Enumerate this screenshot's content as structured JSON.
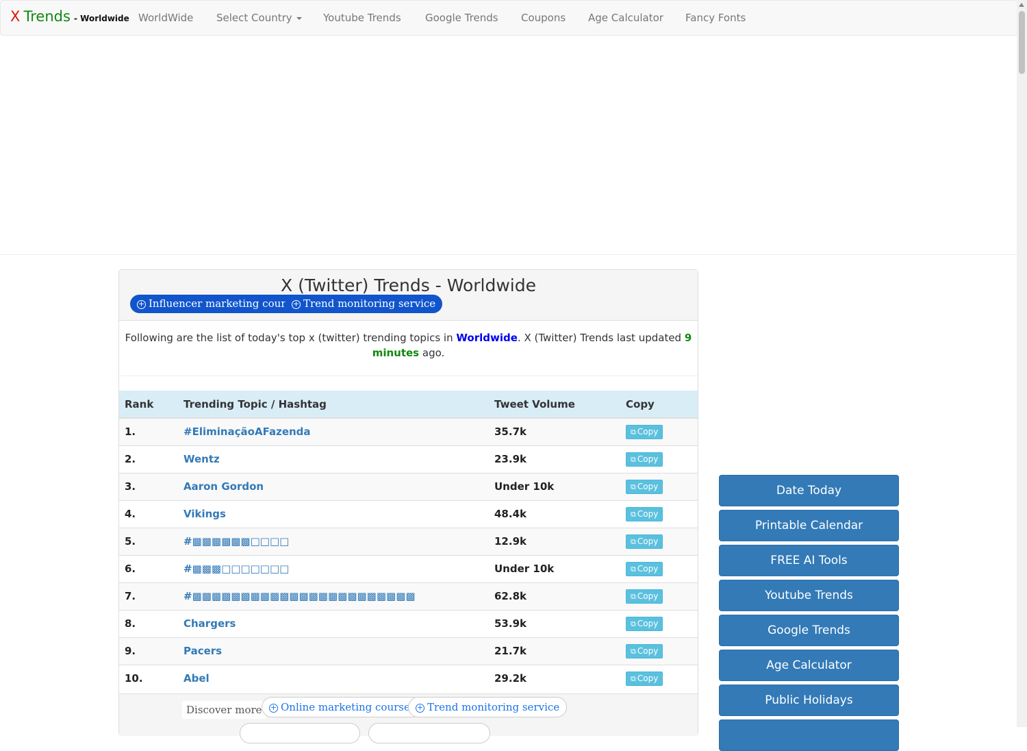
{
  "nav": {
    "brand_x": "X",
    "brand_trends": "Trends",
    "brand_region": "- Worldwide",
    "items": [
      "WorldWide",
      "Select Country",
      "Youtube Trends",
      "Google Trends",
      "Coupons",
      "Age Calculator",
      "Fancy Fonts"
    ]
  },
  "panel": {
    "title": "X (Twitter) Trends - Worldwide",
    "pills": [
      "Influencer marketing courses",
      "Trend monitoring service"
    ],
    "intro_prefix": "Following are the list of today's top x (twitter) trending topics in",
    "intro_location": "Worldwide",
    "intro_middle": ". X (Twitter) Trends last updated",
    "intro_updated": "9 minutes",
    "intro_suffix": "ago."
  },
  "table": {
    "headers": [
      "Rank",
      "Trending Topic / Hashtag",
      "Tweet Volume",
      "Copy"
    ],
    "copy_label": "Copy",
    "rows": [
      {
        "rank": "1.",
        "topic": "#EliminaçãoAFazenda",
        "volume": "35.7k"
      },
      {
        "rank": "2.",
        "topic": "Wentz",
        "volume": "23.9k"
      },
      {
        "rank": "3.",
        "topic": "Aaron Gordon",
        "volume": "Under 10k"
      },
      {
        "rank": "4.",
        "topic": "Vikings",
        "volume": "48.4k"
      },
      {
        "rank": "5.",
        "topic": "#▩▩▩▩▩▩□□□□",
        "volume": "12.9k"
      },
      {
        "rank": "6.",
        "topic": "#▩▩▩□□□□□□□",
        "volume": "Under 10k"
      },
      {
        "rank": "7.",
        "topic": "#▩▩▩▩▩▩▩▩▩▩▩▩▩▩▩▩▩▩▩▩▩▩▩",
        "volume": "62.8k"
      },
      {
        "rank": "8.",
        "topic": "Chargers",
        "volume": "53.9k"
      },
      {
        "rank": "9.",
        "topic": "Pacers",
        "volume": "21.7k"
      },
      {
        "rank": "10.",
        "topic": "Abel",
        "volume": "29.2k"
      }
    ]
  },
  "discover": {
    "label": "Discover more",
    "pills": [
      "Online marketing courses",
      "Trend monitoring service"
    ]
  },
  "sidebar": {
    "buttons": [
      "Date Today",
      "Printable Calendar",
      "FREE AI Tools",
      "Youtube Trends",
      "Google Trends",
      "Age Calculator",
      "Public Holidays"
    ]
  }
}
